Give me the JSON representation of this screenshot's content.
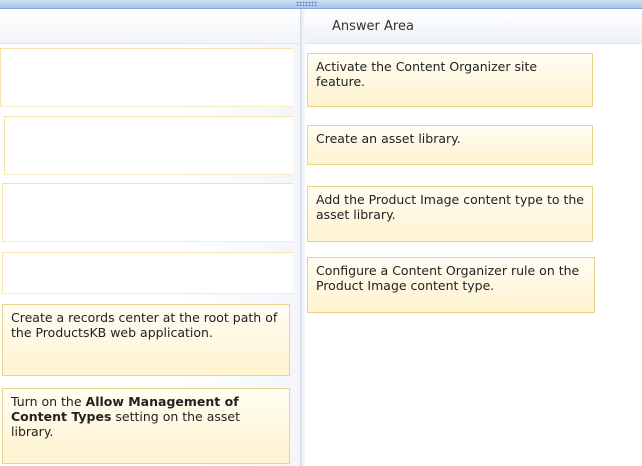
{
  "answer_area": {
    "title": "Answer Area",
    "items": [
      "Activate the Content Organizer site feature.",
      "Create an asset library.",
      "Add the Product Image content type to the asset library.",
      "Configure a Content Organizer rule on the Product Image content type."
    ]
  },
  "choices": {
    "item1": "Create a records center at the root path of the ProductsKB web application.",
    "item2": {
      "prefix": "Turn on the ",
      "bold": "Allow Management of Content Types",
      "suffix": " setting on the asset library."
    }
  },
  "colors": {
    "card_border": "#e9d28a",
    "card_fill": "#fff3cf",
    "splitter": "#a9c6ea"
  }
}
